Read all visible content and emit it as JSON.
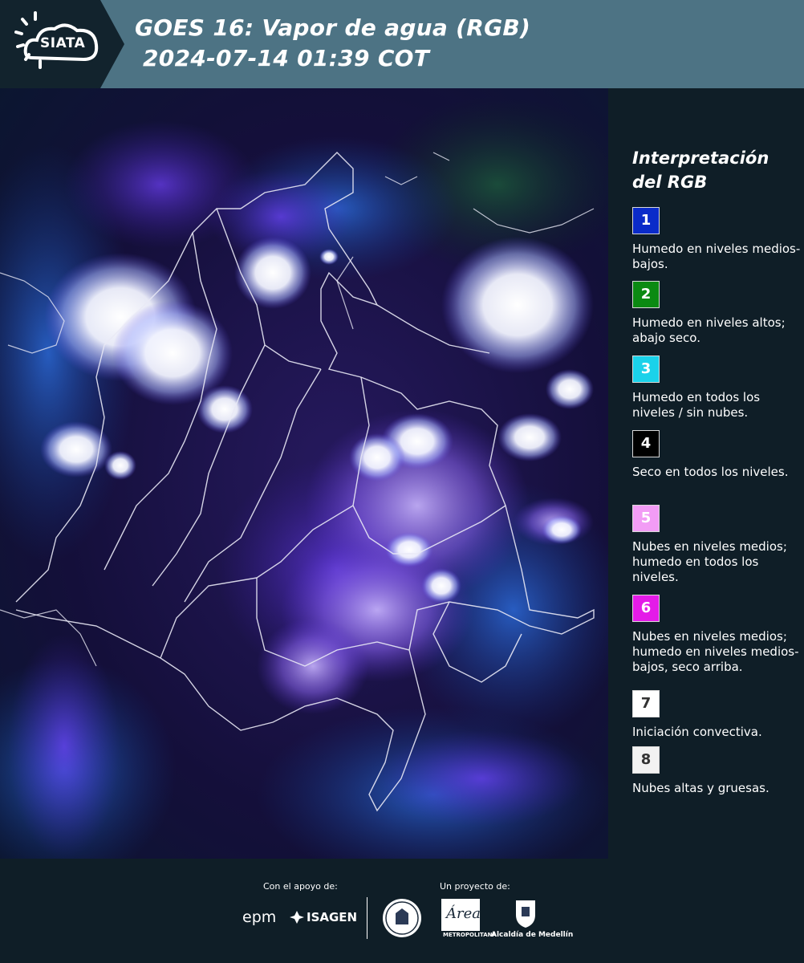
{
  "header": {
    "title_line1": "GOES 16: Vapor de agua (RGB)",
    "title_line2": "2024-07-14 01:39 COT",
    "logo_text": "SIATA",
    "background_color": "#4d7384"
  },
  "legend": {
    "title": "Interpretación del RGB",
    "items": [
      {
        "number": "1",
        "color": "#0a2bc9",
        "text_color": "#ffffff",
        "description": "Humedo en niveles medios-bajos."
      },
      {
        "number": "2",
        "color": "#0b8a12",
        "text_color": "#ffffff",
        "description": "Humedo en niveles altos; abajo seco."
      },
      {
        "number": "3",
        "color": "#1ad2ea",
        "text_color": "#ffffff",
        "description": "Humedo en todos los niveles / sin nubes."
      },
      {
        "number": "4",
        "color": "#000000",
        "text_color": "#ffffff",
        "description": "Seco en todos los niveles."
      },
      {
        "number": "5",
        "color": "#f29cf5",
        "text_color": "#ffffff",
        "description": "Nubes en niveles medios; humedo en todos los niveles."
      },
      {
        "number": "6",
        "color": "#e41be8",
        "text_color": "#ffffff",
        "description": "Nubes en niveles medios; humedo en niveles medios-bajos, seco arriba."
      },
      {
        "number": "7",
        "color": "#ffffff",
        "text_color": "#333333",
        "description": "Iniciación convectiva."
      },
      {
        "number": "8",
        "color": "#f2f2f2",
        "text_color": "#333333",
        "description": "Nubes altas y gruesas."
      }
    ]
  },
  "footer": {
    "support_label": "Con el apoyo de:",
    "project_label": "Un proyecto de:",
    "sponsors": [
      "epm",
      "ISAGEN"
    ],
    "project_partners": [
      "Área Metropolitana Valle de Aburrá",
      "Alcaldía de Medellín"
    ],
    "logo_captions": {
      "metropolitana": "METROPOLITANA",
      "alcaldia": "Alcaldía de Medellín"
    }
  }
}
